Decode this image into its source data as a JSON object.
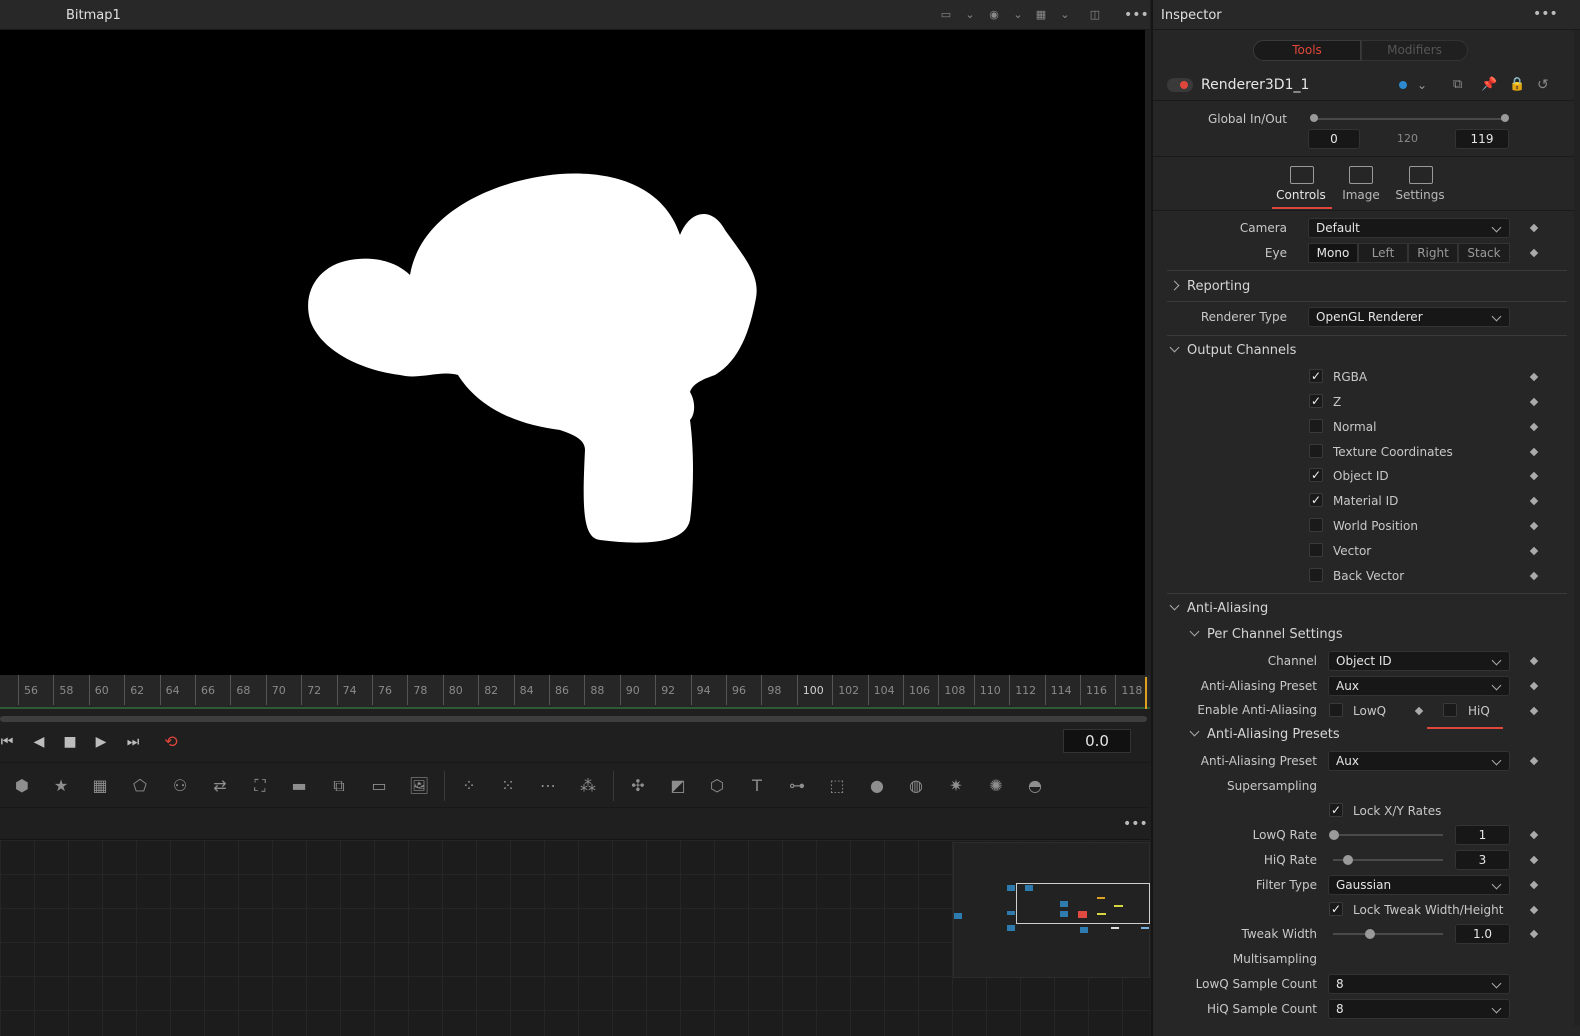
{
  "viewer": {
    "title": "Bitmap1",
    "time_value": "0.0",
    "ruler_ticks": [
      "56",
      "58",
      "60",
      "62",
      "64",
      "66",
      "68",
      "70",
      "72",
      "74",
      "76",
      "78",
      "80",
      "82",
      "84",
      "86",
      "88",
      "90",
      "92",
      "94",
      "96",
      "98",
      "100",
      "102",
      "104",
      "106",
      "108",
      "110",
      "112",
      "114",
      "116",
      "118"
    ]
  },
  "inspector": {
    "title": "Inspector",
    "tab_tools": "Tools",
    "tab_modifiers": "Modifiers",
    "node_name": "Renderer3D1_1",
    "global_inout_label": "Global In/Out",
    "global_in": "0",
    "global_mid": "120",
    "global_out": "119",
    "subtabs": {
      "controls": "Controls",
      "image": "Image",
      "settings": "Settings"
    },
    "camera_label": "Camera",
    "camera_value": "Default",
    "eye_label": "Eye",
    "eye_options": [
      "Mono",
      "Left",
      "Right",
      "Stack"
    ],
    "eye_selected": "Mono",
    "reporting": "Reporting",
    "renderer_type_label": "Renderer Type",
    "renderer_type_value": "OpenGL Renderer",
    "output_channels": "Output Channels",
    "channels": [
      {
        "label": "RGBA",
        "checked": true
      },
      {
        "label": "Z",
        "checked": true
      },
      {
        "label": "Normal",
        "checked": false
      },
      {
        "label": "Texture Coordinates",
        "checked": false
      },
      {
        "label": "Object ID",
        "checked": true
      },
      {
        "label": "Material ID",
        "checked": true
      },
      {
        "label": "World Position",
        "checked": false
      },
      {
        "label": "Vector",
        "checked": false
      },
      {
        "label": "Back Vector",
        "checked": false
      }
    ],
    "anti_aliasing": "Anti-Aliasing",
    "per_channel_settings": "Per Channel Settings",
    "channel_label": "Channel",
    "channel_value": "Object ID",
    "aa_preset_label": "Anti-Aliasing Preset",
    "aa_preset_value": "Aux",
    "enable_aa_label": "Enable Anti-Aliasing",
    "lowq": "LowQ",
    "hiq": "HiQ",
    "aa_presets": "Anti-Aliasing Presets",
    "aa_preset2_label": "Anti-Aliasing Preset",
    "aa_preset2_value": "Aux",
    "supersampling": "Supersampling",
    "lock_xy": "Lock X/Y Rates",
    "lowq_rate_label": "LowQ Rate",
    "lowq_rate_value": "1",
    "hiq_rate_label": "HiQ Rate",
    "hiq_rate_value": "3",
    "filter_type_label": "Filter Type",
    "filter_type_value": "Gaussian",
    "lock_tweak": "Lock Tweak Width/Height",
    "tweak_width_label": "Tweak Width",
    "tweak_width_value": "1.0",
    "multisampling": "Multisampling",
    "lowq_sample_label": "LowQ Sample Count",
    "lowq_sample_value": "8",
    "hiq_sample_label": "HiQ Sample Count",
    "hiq_sample_value": "8"
  },
  "colors": {
    "accent_red": "#e0473a",
    "timeline_green": "#2e5a33"
  }
}
